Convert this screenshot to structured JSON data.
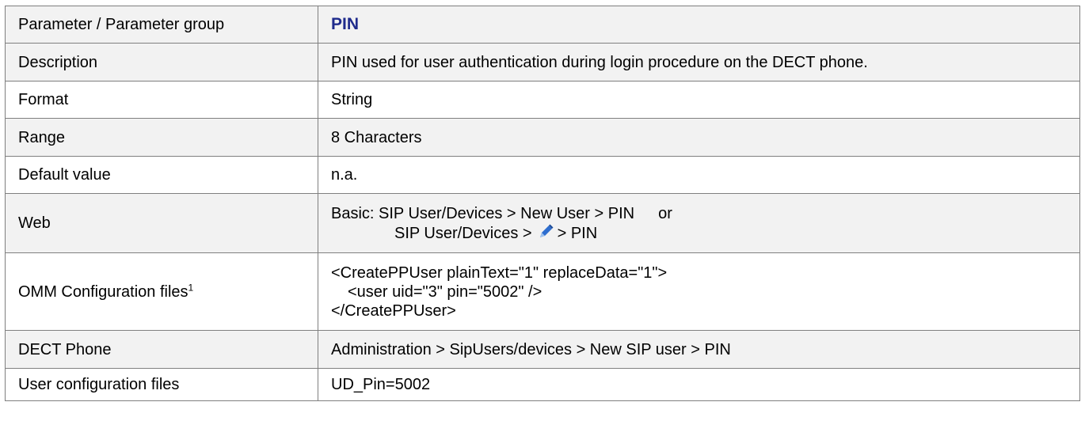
{
  "table": {
    "header": {
      "label": "Parameter / Parameter group",
      "value": "PIN"
    },
    "description": {
      "label": "Description",
      "value": "PIN used for user authentication during login procedure on the DECT phone."
    },
    "format": {
      "label": "Format",
      "value": "String"
    },
    "range": {
      "label": "Range",
      "value": "8 Characters"
    },
    "default": {
      "label": "Default value",
      "value": "n.a."
    },
    "web": {
      "label": "Web",
      "line1": "Basic: SIP User/Devices > New User > PIN",
      "line1_suffix": "or",
      "line2_prefix": "SIP User/Devices >",
      "line2_icon": "pencil-icon",
      "line2_suffix": "> PIN"
    },
    "omm": {
      "label": "OMM Configuration files",
      "footnote": "1",
      "lines": [
        "<CreatePPUser plainText=\"1\" replaceData=\"1\">",
        "<user uid=\"3\" pin=\"5002\" />",
        "</CreatePPUser>"
      ]
    },
    "dect_phone": {
      "label": "DECT Phone",
      "value": "Administration > SipUsers/devices > New SIP user > PIN"
    },
    "user_config": {
      "label": "User configuration files",
      "value": "UD_Pin=5002"
    }
  },
  "colors": {
    "title_accent": "#1f2b8c",
    "shaded_row": "#f2f2f2",
    "border": "#7f7f7f"
  }
}
